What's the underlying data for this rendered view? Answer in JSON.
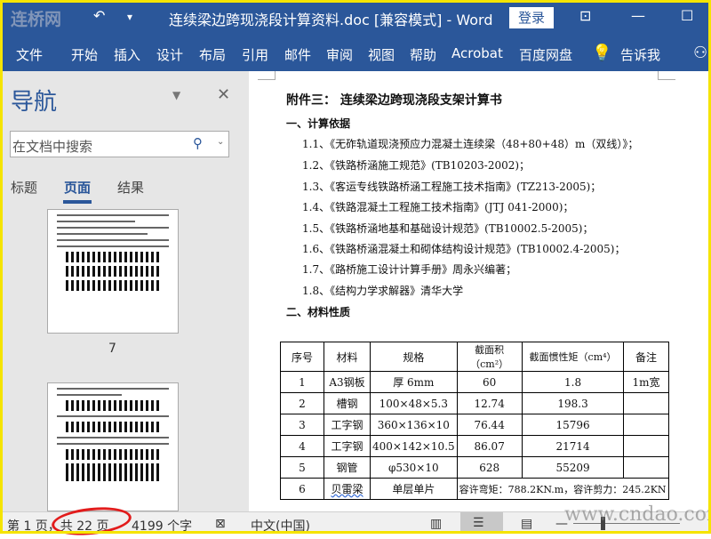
{
  "watermark_top": "连桥网",
  "watermark_bottom": "www.cndao.com",
  "titlebar": {
    "title": "连续梁边跨现浇段计算资料.doc [兼容模式]  -  Word",
    "login": "登录",
    "undo_icon": "↶",
    "qa_icon": "▾",
    "restore_icon": "⊡",
    "min_icon": "—",
    "max_icon": "☐"
  },
  "ribbon": {
    "tabs": [
      "文件",
      "开始",
      "插入",
      "设计",
      "布局",
      "引用",
      "邮件",
      "审阅",
      "视图",
      "帮助",
      "Acrobat",
      "百度网盘"
    ],
    "tell": "告诉我"
  },
  "nav": {
    "title": "导航",
    "search_placeholder": "在文档中搜索",
    "tabs": [
      "标题",
      "页面",
      "结果"
    ],
    "thumb_label": "7"
  },
  "doc": {
    "title": "附件三：  连续梁边跨现浇段支架计算书",
    "sec1": "一、计算依据",
    "refs": [
      "1.1、《无砟轨道现浇预应力混凝土连续梁（48+80+48）m（双线）》；",
      "1.2、《铁路桥涵施工规范》(TB10203-2002)；",
      "1.3、《客运专线铁路桥涵工程施工技术指南》(TZ213-2005)；",
      "1.4、《铁路混凝土工程施工技术指南》(JTJ 041-2000)；",
      "1.5、《铁路桥涵地基和基础设计规范》(TB10002.5-2005)；",
      "1.6、《铁路桥涵混凝土和砌体结构设计规范》(TB10002.4-2005)；",
      "1.7、《路桥施工设计计算手册》周永兴编著；",
      "1.8、《结构力学求解器》清华大学"
    ],
    "sec2": "二、材料性质",
    "table": {
      "headers": [
        "序号",
        "材料",
        "规格",
        "截面积（cm²）",
        "截面惯性矩（cm⁴）",
        "备注"
      ],
      "rows": [
        [
          "1",
          "A3钢板",
          "厚 6mm",
          "60",
          "1.8",
          "1m宽"
        ],
        [
          "2",
          "槽钢",
          "100×48×5.3",
          "12.74",
          "198.3",
          ""
        ],
        [
          "3",
          "工字钢",
          "360×136×10",
          "76.44",
          "15796",
          ""
        ],
        [
          "4",
          "工字钢",
          "400×142×10.5",
          "86.07",
          "21714",
          ""
        ],
        [
          "5",
          "钢管",
          "φ530×10",
          "628",
          "55209",
          ""
        ]
      ],
      "row6": [
        "6",
        "贝雷梁",
        "单层单片",
        "容许弯矩：788.2KN.m，容许剪力：245.2KN"
      ]
    }
  },
  "status": {
    "page": "第 1 页，共 22 页",
    "words": "4199 个字",
    "lang": "中文(中国)",
    "zoom_minus": "—"
  }
}
